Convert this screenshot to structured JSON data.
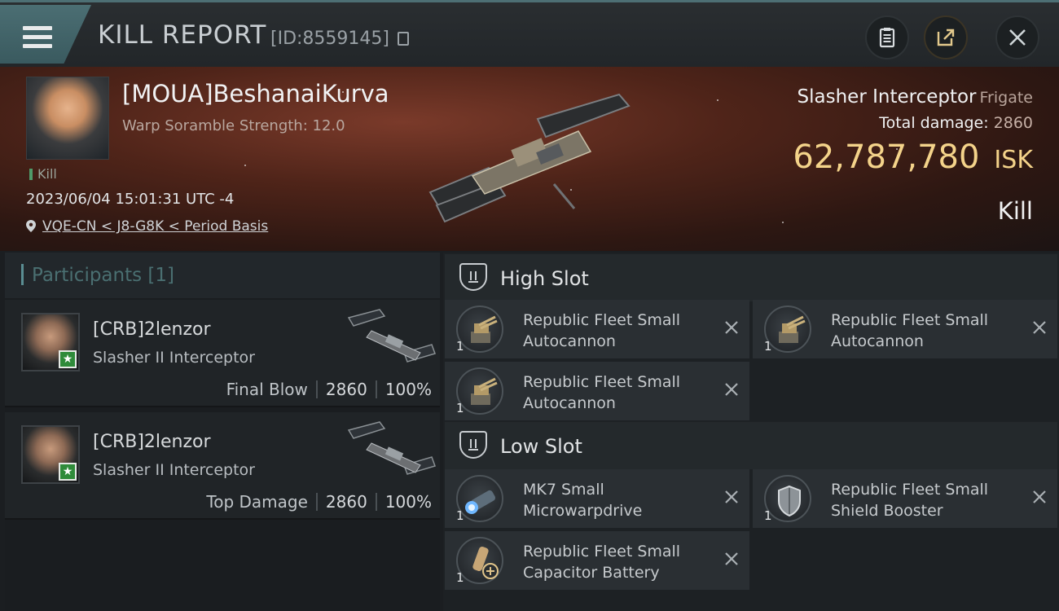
{
  "header": {
    "title": "KILL REPORT",
    "report_id": "[ID:8559145]",
    "icons": [
      "menu-icon",
      "copy-icon",
      "clipboard-icon",
      "share-icon",
      "close-icon"
    ]
  },
  "victim": {
    "name": "[MOUA]BeshanaiKurva",
    "warp_scramble": "Warp Soramble Strength: 12.0",
    "kill_tag": "Kill",
    "datetime": "2023/06/04 15:01:31 UTC -4",
    "location": "VQE-CN < J8-G8K < Period Basis",
    "ship_name": "Slasher Interceptor",
    "ship_class": "Frigate",
    "total_damage_label": "Total damage:",
    "total_damage": "2860",
    "isk_value": "62,787,780",
    "isk_unit": "ISK",
    "result": "Kill"
  },
  "participants": {
    "title": "Participants [1]",
    "items": [
      {
        "name": "[CRB]2lenzor",
        "ship": "Slasher II Interceptor",
        "role": "Final Blow",
        "damage": "2860",
        "percent": "100%"
      },
      {
        "name": "[CRB]2lenzor",
        "ship": "Slasher II Interceptor",
        "role": "Top Damage",
        "damage": "2860",
        "percent": "100%"
      }
    ]
  },
  "slots": {
    "high": {
      "label": "High Slot",
      "modules": [
        {
          "name_line1": "Republic Fleet Small",
          "name_line2": "Autocannon",
          "qty": "1",
          "icon": "autocannon-icon"
        },
        {
          "name_line1": "Republic Fleet Small",
          "name_line2": "Autocannon",
          "qty": "1",
          "icon": "autocannon-icon"
        },
        {
          "name_line1": "Republic Fleet Small",
          "name_line2": "Autocannon",
          "qty": "1",
          "icon": "autocannon-icon"
        }
      ]
    },
    "low": {
      "label": "Low Slot",
      "modules": [
        {
          "name_line1": "MK7 Small",
          "name_line2": "Microwarpdrive",
          "qty": "1",
          "icon": "microwarpdrive-icon"
        },
        {
          "name_line1": "Republic Fleet Small",
          "name_line2": "Shield Booster",
          "qty": "1",
          "icon": "shield-booster-icon"
        },
        {
          "name_line1": "Republic Fleet Small",
          "name_line2": "Capacitor Battery",
          "qty": "1",
          "icon": "capacitor-battery-icon"
        }
      ]
    }
  },
  "colors": {
    "accent": "#4b6e73",
    "isk": "#f4d38a",
    "banner": "#5a2a1d"
  }
}
